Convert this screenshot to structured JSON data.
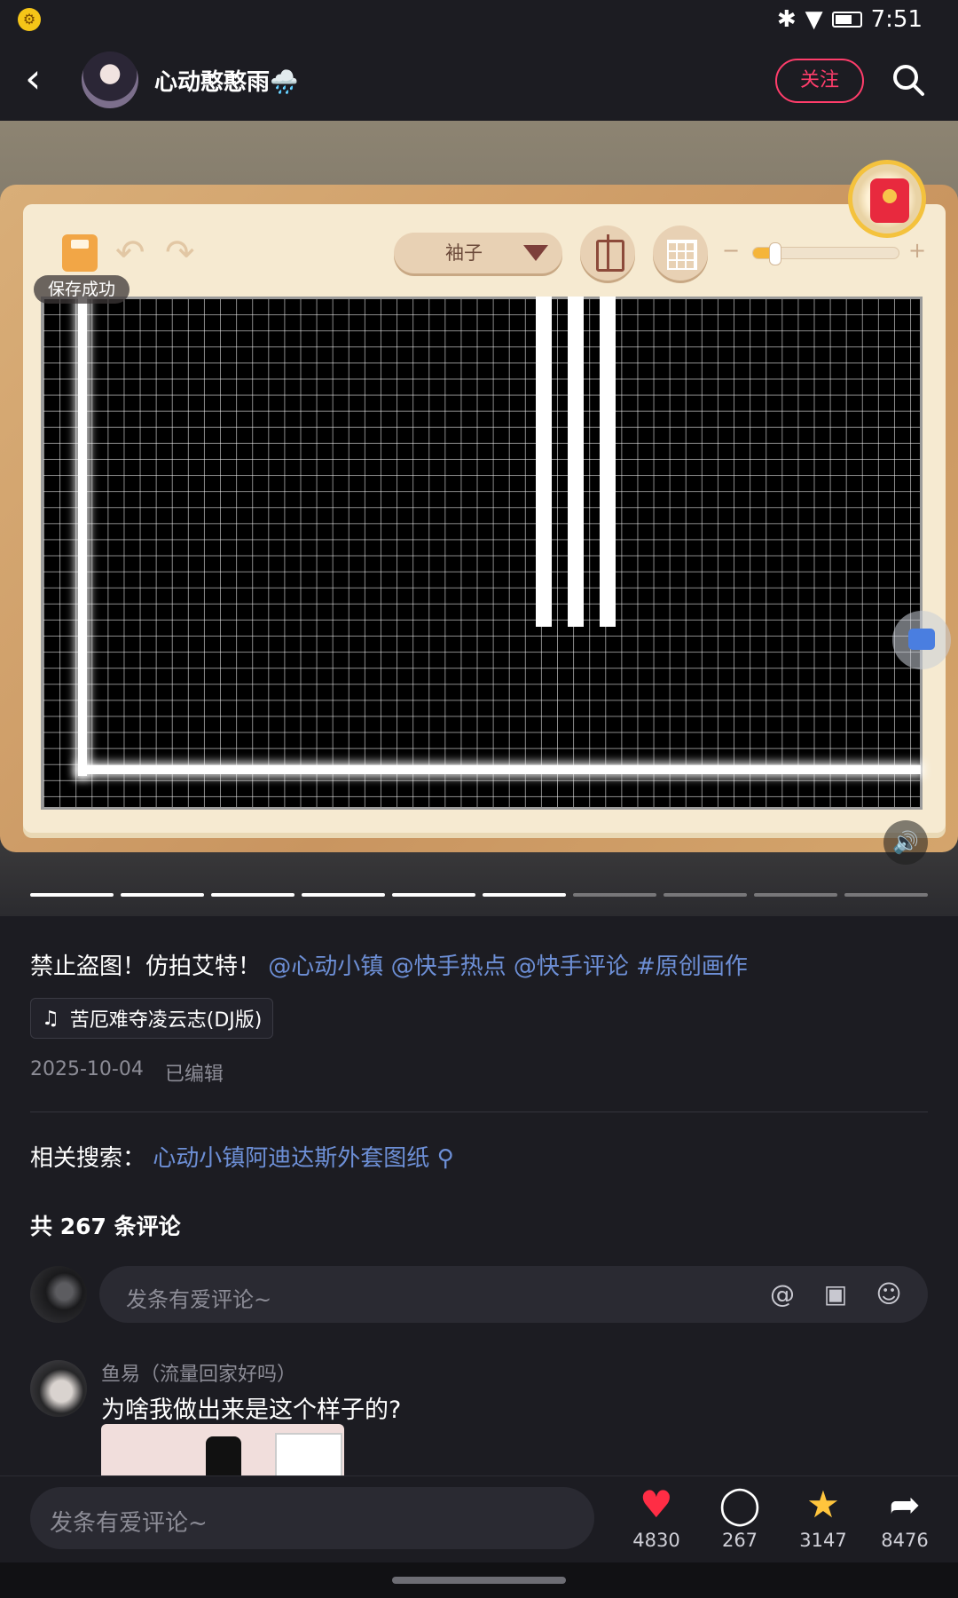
{
  "status": {
    "time": "7:51"
  },
  "header": {
    "author": "心动憨憨雨🌧️",
    "follow_label": "关注"
  },
  "editor": {
    "save_toast": "保存成功",
    "part_select": "袖子",
    "zoom_level": 0.15
  },
  "media": {
    "progress_segments_total": 10,
    "progress_segments_done": 6
  },
  "post": {
    "caption": "禁止盗图！仿拍艾特！",
    "mentions": [
      "@心动小镇",
      "@快手热点",
      "@快手评论"
    ],
    "hashtag": "#原创画作",
    "music": "苦厄难夺凌云志(DJ版)",
    "date": "2025-10-04",
    "edited": "已编辑",
    "related_label": "相关搜索：",
    "related_term": "心动小镇阿迪达斯外套图纸"
  },
  "comments": {
    "count_label": "共 267 条评论",
    "input_placeholder": "发条有爱评论~",
    "items": [
      {
        "user": "鱼易（流量回家好吗）",
        "text": "为啥我做出来是这个样子的?"
      }
    ]
  },
  "bottom": {
    "input_placeholder": "发条有爱评论~",
    "likes": "4830",
    "comments": "267",
    "favorites": "3147",
    "shares": "8476"
  },
  "colors": {
    "accent": "#ff3d6b",
    "link": "#6d8fd6",
    "like": "#ff2d45",
    "favorite": "#ffc53d"
  }
}
